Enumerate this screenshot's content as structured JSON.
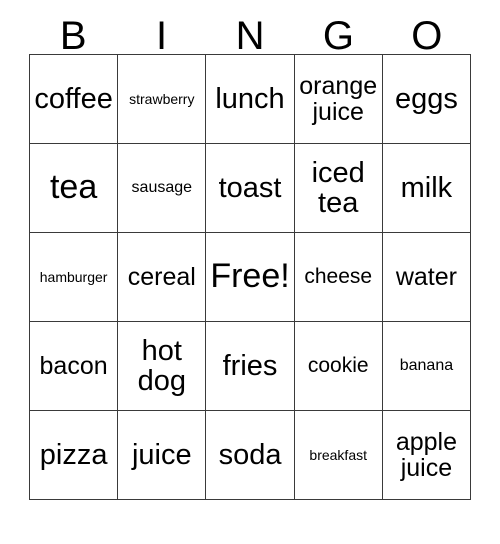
{
  "card": {
    "title": "BINGO",
    "header_letters": [
      "B",
      "I",
      "N",
      "G",
      "O"
    ],
    "free_space_label": "Free!",
    "border_color": "#3a3a3a",
    "background_color": "#ffffff",
    "text_color": "#000000",
    "columns": 5,
    "rows": 5,
    "cells": [
      {
        "text": "coffee",
        "size": "lg",
        "column": "B",
        "row": 1
      },
      {
        "text": "strawberry",
        "size": "xxs",
        "column": "I",
        "row": 1
      },
      {
        "text": "lunch",
        "size": "lg",
        "column": "N",
        "row": 1
      },
      {
        "text": "orange juice",
        "size": "md",
        "column": "G",
        "row": 1
      },
      {
        "text": "eggs",
        "size": "lg",
        "column": "O",
        "row": 1
      },
      {
        "text": "tea",
        "size": "xl",
        "column": "B",
        "row": 2
      },
      {
        "text": "sausage",
        "size": "xs",
        "column": "I",
        "row": 2
      },
      {
        "text": "toast",
        "size": "lg",
        "column": "N",
        "row": 2
      },
      {
        "text": "iced tea",
        "size": "lg",
        "column": "G",
        "row": 2
      },
      {
        "text": "milk",
        "size": "lg",
        "column": "O",
        "row": 2
      },
      {
        "text": "hamburger",
        "size": "xxs",
        "column": "B",
        "row": 3
      },
      {
        "text": "cereal",
        "size": "md",
        "column": "I",
        "row": 3
      },
      {
        "text": "Free!",
        "size": "xl",
        "column": "N",
        "row": 3
      },
      {
        "text": "cheese",
        "size": "sm",
        "column": "G",
        "row": 3
      },
      {
        "text": "water",
        "size": "md",
        "column": "O",
        "row": 3
      },
      {
        "text": "bacon",
        "size": "md",
        "column": "B",
        "row": 4
      },
      {
        "text": "hot dog",
        "size": "lg",
        "column": "I",
        "row": 4
      },
      {
        "text": "fries",
        "size": "lg",
        "column": "N",
        "row": 4
      },
      {
        "text": "cookie",
        "size": "sm",
        "column": "G",
        "row": 4
      },
      {
        "text": "banana",
        "size": "xs",
        "column": "O",
        "row": 4
      },
      {
        "text": "pizza",
        "size": "lg",
        "column": "B",
        "row": 5
      },
      {
        "text": "juice",
        "size": "lg",
        "column": "I",
        "row": 5
      },
      {
        "text": "soda",
        "size": "lg",
        "column": "N",
        "row": 5
      },
      {
        "text": "breakfast",
        "size": "xxs",
        "column": "G",
        "row": 5
      },
      {
        "text": "apple juice",
        "size": "md",
        "column": "O",
        "row": 5
      }
    ]
  }
}
